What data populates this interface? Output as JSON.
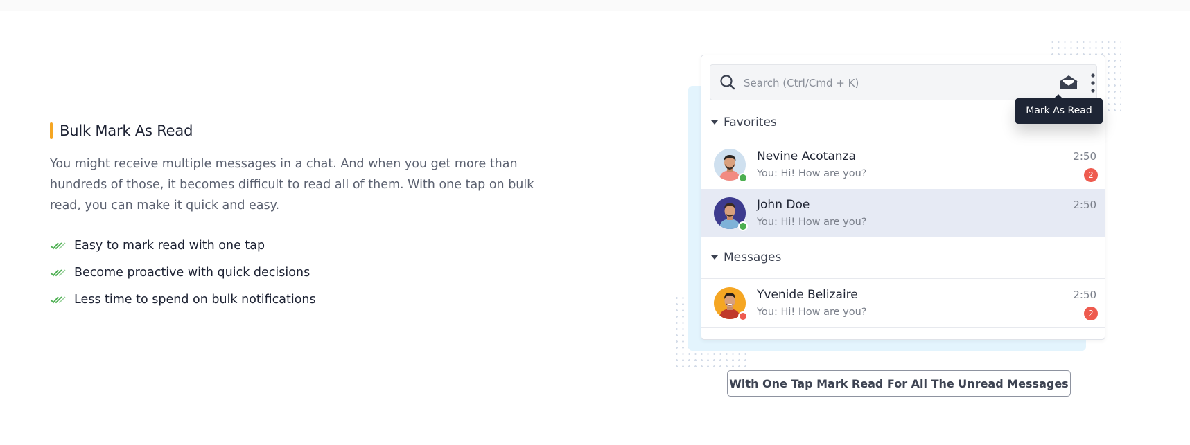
{
  "feature": {
    "title": "Bulk Mark As Read",
    "description": "You might receive multiple messages in a chat. And when you get more than hundreds of those, it becomes difficult to read all of them. With one tap on bulk read, you can make it quick and easy.",
    "bullets": [
      "Easy to mark read with one tap",
      "Become proactive with quick decisions",
      "Less time to spend on bulk notifications"
    ]
  },
  "chat_widget": {
    "search_placeholder": "Search (Ctrl/Cmd + K)",
    "tooltip": "Mark As Read",
    "sections": [
      {
        "label": "Favorites",
        "contacts": [
          {
            "name": "Nevine Acotanza",
            "message": "You: Hi! How are you?",
            "time": "2:50",
            "unread": "2",
            "status": "online"
          },
          {
            "name": "John Doe",
            "message": "You: Hi! How are you?",
            "time": "2:50",
            "unread": "",
            "status": "online"
          }
        ]
      },
      {
        "label": "Messages",
        "contacts": [
          {
            "name": "Yvenide Belizaire",
            "message": "You: Hi! How are you?",
            "time": "2:50",
            "unread": "2",
            "status": "offline"
          }
        ]
      }
    ]
  },
  "caption_button": "With One Tap Mark Read For All The Unread Messages",
  "colors": {
    "accent_bar": "#f5a623",
    "check_green": "#4caf50",
    "badge_red": "#ee5b4f",
    "online_green": "#4caf50",
    "offline_red": "#ee5b4f",
    "tooltip_bg": "#1e2535",
    "active_row": "#e6eaf4"
  },
  "icons": [
    "double-check-icon",
    "search-icon",
    "envelope-open-icon",
    "kebab-menu-icon",
    "caret-down-icon"
  ]
}
